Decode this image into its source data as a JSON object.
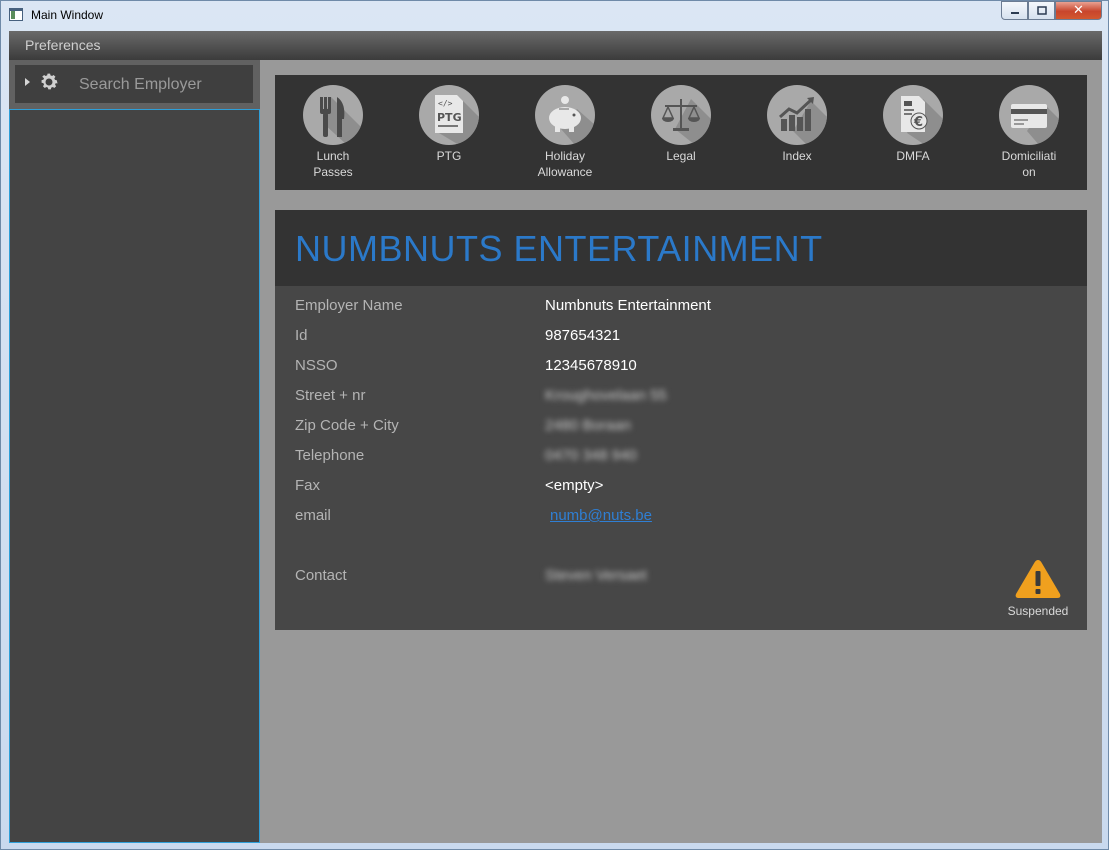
{
  "window": {
    "title": "Main Window",
    "controls": {
      "minimize": "▭",
      "maximize": "◻",
      "close": "✕"
    }
  },
  "menu": {
    "items": [
      "Preferences"
    ]
  },
  "sidebar": {
    "search_placeholder": "Search Employer"
  },
  "toolbar": {
    "items": [
      {
        "label": "Lunch\nPasses",
        "icon": "fork-knife-icon"
      },
      {
        "label": "PTG",
        "icon": "ptg-document-icon"
      },
      {
        "label": "Holiday\nAllowance",
        "icon": "piggy-bank-icon"
      },
      {
        "label": "Legal",
        "icon": "scales-icon"
      },
      {
        "label": "Index",
        "icon": "chart-up-icon"
      },
      {
        "label": "DMFA",
        "icon": "euro-document-icon"
      },
      {
        "label": "Domiciliati\non",
        "icon": "credit-card-icon"
      }
    ]
  },
  "employer": {
    "title": "NUMBNUTS ENTERTAINMENT",
    "fields": [
      {
        "label": "Employer Name",
        "value": "Numbnuts Entertainment"
      },
      {
        "label": "Id",
        "value": "987654321"
      },
      {
        "label": "NSSO",
        "value": "12345678910"
      },
      {
        "label": "Street + nr",
        "value": "Kroughovelaan 55"
      },
      {
        "label": "Zip Code + City",
        "value": "2480 Boraan"
      },
      {
        "label": "Telephone",
        "value": "0470 348 940"
      },
      {
        "label": "Fax",
        "value": "<empty>"
      },
      {
        "label": "email",
        "value": "numb@nuts.be"
      },
      {
        "label": "Contact",
        "value": "Steven Versaet"
      }
    ],
    "status": {
      "label": "Suspended",
      "icon": "warning-icon",
      "color": "#f0a01e"
    }
  },
  "colors": {
    "accent": "#2b79c9",
    "link": "#2f7fd4",
    "focus_border": "#2e9fd8"
  }
}
